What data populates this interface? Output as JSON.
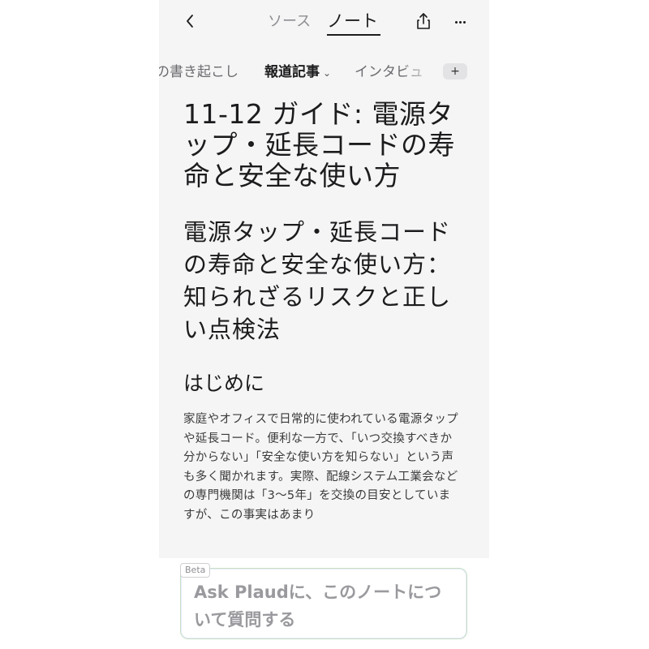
{
  "nav": {
    "back_icon": "chevron-left-icon",
    "tabs": [
      {
        "label": "ソース",
        "active": false
      },
      {
        "label": "ノート",
        "active": true
      }
    ],
    "share_icon": "share-icon",
    "more_icon": "more-horizontal-icon"
  },
  "templates": {
    "items": [
      {
        "label": "の書き起こし",
        "active": false
      },
      {
        "label": "報道記事",
        "active": true
      },
      {
        "label": "インタビュ",
        "active": false
      }
    ],
    "add_label": "+"
  },
  "note": {
    "title": "11-12 ガイド: 電源タップ・延長コードの寿命と安全な使い方",
    "article_title": "電源タップ・延長コードの寿命と安全な使い方：知られざるリスクと正しい点検法",
    "section_heading": "はじめに",
    "body": "家庭やオフィスで日常的に使われている電源タップや延長コード。便利な一方で、「いつ交換すべきか分からない」「安全な使い方を知らない」という声も多く聞かれます。実際、配線システム工業会などの専門機関は「3〜5年」を交換の目安としていますが、この事実はあまり"
  },
  "ask": {
    "badge": "Beta",
    "placeholder": "Ask Plaudに、このノートについて質問する"
  },
  "colors": {
    "background": "#f5f5f5",
    "text": "#1c1c1e",
    "muted": "#8e8e93",
    "ask_border": "#c6dfc4"
  }
}
